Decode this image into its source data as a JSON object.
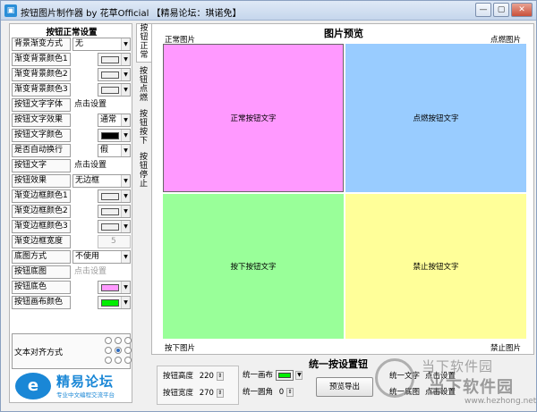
{
  "window": {
    "title": "按钮图片制作器 by 花草Official 【精易论坛：琪诺免】",
    "min": "—",
    "max": "▢",
    "close": "✕"
  },
  "settings": {
    "title": "按钮正常设置",
    "rows": [
      {
        "label": "背景渐变方式",
        "kind": "combo",
        "value": "无"
      },
      {
        "label": "渐变背景颜色1",
        "kind": "color",
        "color": "#f0f0f0"
      },
      {
        "label": "渐变背景颜色2",
        "kind": "color",
        "color": "#f0f0f0"
      },
      {
        "label": "渐变背景颜色3",
        "kind": "color",
        "color": "#f0f0f0"
      },
      {
        "label": "按钮文字字体",
        "kind": "text",
        "value": "点击设置"
      },
      {
        "label": "按钮文字效果",
        "kind": "combo-short",
        "value": "通常"
      },
      {
        "label": "按钮文字颜色",
        "kind": "color",
        "color": "#000000"
      },
      {
        "label": "是否自动换行",
        "kind": "combo-short",
        "value": "假"
      },
      {
        "label": "按钮文字",
        "kind": "text",
        "value": "点击设置"
      },
      {
        "label": "按钮效果",
        "kind": "combo",
        "value": "无边框"
      },
      {
        "label": "渐变边框颜色1",
        "kind": "color",
        "color": "#f0f0f0"
      },
      {
        "label": "渐变边框颜色2",
        "kind": "color",
        "color": "#f0f0f0"
      },
      {
        "label": "渐变边框颜色3",
        "kind": "color",
        "color": "#f0f0f0"
      },
      {
        "label": "渐变边框宽度",
        "kind": "spin",
        "value": "5"
      },
      {
        "label": "底图方式",
        "kind": "combo",
        "value": "不使用"
      },
      {
        "label": "按钮底图",
        "kind": "text-gray",
        "value": "点击设置"
      },
      {
        "label": "按钮底色",
        "kind": "color",
        "color": "#ff99ff"
      },
      {
        "label": "按钮画布颜色",
        "kind": "color",
        "color": "#00ee00"
      }
    ],
    "align_label": "文本对齐方式"
  },
  "logo": {
    "mark": "e",
    "name": "精易论坛",
    "sub": "专业中文编程交流平台"
  },
  "tabs": [
    {
      "chars": [
        "按",
        "钮",
        "正",
        "常"
      ],
      "active": true
    },
    {
      "chars": [
        "按",
        "钮",
        "点",
        "燃"
      ],
      "active": false
    },
    {
      "chars": [
        "按",
        "钮",
        "按",
        "下"
      ],
      "active": false
    },
    {
      "chars": [
        "按",
        "钮",
        "停",
        "止"
      ],
      "active": false
    }
  ],
  "preview": {
    "title": "图片预览",
    "corner_tl": "正常图片",
    "corner_tr": "点燃图片",
    "corner_bl": "按下图片",
    "corner_br": "禁止图片",
    "cells": [
      {
        "text": "正常按钮文字",
        "color": "#ff99ff"
      },
      {
        "text": "点燃按钮文字",
        "color": "#99ccff"
      },
      {
        "text": "按下按钮文字",
        "color": "#99ff99"
      },
      {
        "text": "禁止按钮文字",
        "color": "#ffff99"
      }
    ]
  },
  "unify": {
    "title": "统一按设置钮",
    "height_label": "按钮高度",
    "height_value": "220",
    "width_label": "按钮宽度",
    "width_value": "270",
    "canvas_label": "统一画布",
    "radius_label": "统一圆角",
    "radius_value": "0",
    "export_label": "预览导出",
    "text_label": "统一文字",
    "text_value": "点击设置",
    "bg_label": "统一底图",
    "bg_value": "点击设置"
  },
  "watermark": {
    "line1": "当下软件园",
    "line2": "当下软件园",
    "url": "www.hezhong.net"
  }
}
